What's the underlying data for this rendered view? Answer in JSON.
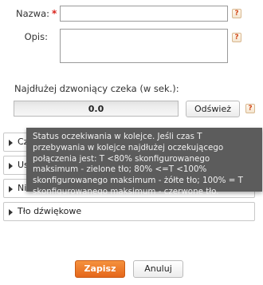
{
  "form": {
    "name_label": "Nazwa:",
    "required_mark": "*",
    "name_value": "",
    "description_label": "Opis:",
    "description_value": "",
    "help_glyph": "?",
    "longest_wait_label": "Najdłużej dzwoniący czeka (w sek.):",
    "longest_wait_value": "0.0",
    "refresh_label": "Odśwież"
  },
  "sections": [
    {
      "label": "Cz",
      "icon": "triangle-right-icon"
    },
    {
      "label": "Us",
      "icon": "triangle-right-icon"
    },
    {
      "label": "Nie",
      "icon": "triangle-right-icon"
    },
    {
      "label": "Tło dźwiękowe",
      "icon": "triangle-right-icon"
    }
  ],
  "tooltip": {
    "text": "Status oczekiwania w kolejce. Jeśli czas T przebywania w kolejce najdłużej oczekującego połączenia jest: T <80% skonfigurowanego maksimum - zielone tło; 80% <=T <100% skonfigurowanego maksimum - żółte tło; 100% = T skonfigurowanego maksimum - czerwone tło."
  },
  "actions": {
    "save_label": "Zapisz",
    "cancel_label": "Anuluj"
  },
  "colors": {
    "accent_orange": "#e5671b",
    "required_red": "#d9231c",
    "tooltip_bg": "#5c5c5c"
  }
}
